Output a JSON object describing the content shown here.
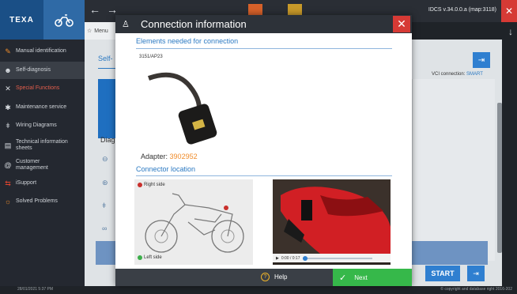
{
  "app": {
    "logo": "TEXA",
    "version": "IDCS v.34.0.0.a (map:3118)"
  },
  "crumb_label": "Menu",
  "sidebar": {
    "items": [
      {
        "label": "Manual identification",
        "icon": "wrench-icon"
      },
      {
        "label": "Self-diagnosis",
        "icon": "person-icon"
      },
      {
        "label": "Special Functions",
        "icon": "wrench-cross-icon"
      },
      {
        "label": "Maintenance service",
        "icon": "gear-icon"
      },
      {
        "label": "Wiring Diagrams",
        "icon": "plug-icon"
      },
      {
        "label": "Technical information sheets",
        "icon": "document-icon"
      },
      {
        "label": "Customer management",
        "icon": "at-icon"
      },
      {
        "label": "iSupport",
        "icon": "support-icon"
      },
      {
        "label": "Solved Problems",
        "icon": "lightbulb-icon"
      }
    ]
  },
  "footer": {
    "date": "28/01/2021 5:37 PM",
    "copyright": "© copyright and database right 2016-202"
  },
  "page": {
    "title": "Self-",
    "vci_label": "VCI connection:",
    "vci_value": "SMART",
    "diag_label": "Diag",
    "start_label": "START"
  },
  "dialog": {
    "title": "Connection information",
    "section_elements": "Elements needed for connection",
    "connector_code": "3151/AP23",
    "adapter_label": "Adapter:",
    "adapter_value": "3902952",
    "section_location": "Connector location",
    "right_side": "Right side",
    "left_side": "Left side",
    "video_time": "0:00 / 0:17",
    "help_label": "Help",
    "next_label": "Next"
  },
  "colors": {
    "accent": "#2b79c2",
    "adapter_code": "#f08c2a",
    "next_button": "#36b84a",
    "close": "#d63a35"
  }
}
